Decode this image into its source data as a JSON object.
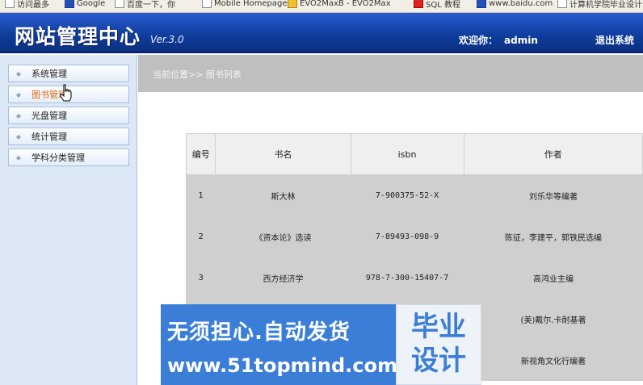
{
  "bookmarks": [
    {
      "label": "访问最多",
      "icon": "page-icon"
    },
    {
      "label": "Google",
      "icon": "google-icon"
    },
    {
      "label": "百度一下，你",
      "icon": "page-icon"
    },
    {
      "label": "Mobile Homepage",
      "icon": "page-icon"
    },
    {
      "label": "EVO2MaxB - EVO2Max",
      "icon": "star-icon"
    },
    {
      "label": "SQL 教程",
      "icon": "red-icon"
    },
    {
      "label": "www.baidu.com",
      "icon": "blue-icon"
    },
    {
      "label": "计算机学院毕业设计",
      "icon": "page-icon"
    }
  ],
  "header": {
    "brand": "网站管理中心",
    "version": "Ver.3.0",
    "welcome_label": "欢迎你：",
    "username": "admin",
    "logout": "退出系统"
  },
  "sidebar": {
    "items": [
      {
        "label": "系统管理",
        "active": false
      },
      {
        "label": "图书管理",
        "active": true
      },
      {
        "label": "光盘管理",
        "active": false
      },
      {
        "label": "统计管理",
        "active": false
      },
      {
        "label": "学科分类管理",
        "active": false
      }
    ]
  },
  "breadcrumb": {
    "text": "当前位置>> 图书列表"
  },
  "table": {
    "headers": [
      "编号",
      "书名",
      "isbn",
      "作者"
    ],
    "rows": [
      [
        "1",
        "斯大林",
        "7-900375-52-X",
        "刘乐华等编著"
      ],
      [
        "2",
        "《资本论》选读",
        "7-89493-098-9",
        "陈征，李建平，郭铁民选编"
      ],
      [
        "3",
        "西方经济学",
        "978-7-300-15407-7",
        "高鸿业主编"
      ],
      [
        "",
        "",
        "",
        "(美)戴尔.卡耐基著"
      ],
      [
        "",
        "",
        "",
        "新视角文化行编著"
      ]
    ]
  },
  "watermark": {
    "slogan": "无须担心.自动发货",
    "site": "www.51topmind.com",
    "badge": "毕业\n设计"
  },
  "colors": {
    "header_bg": "#103f9e",
    "sidebar_bg": "#dce8f6",
    "active_menu_text": "#d9680a",
    "breadcrumb_bg": "#bfbfbf",
    "row_bg": "#cfcfcf",
    "watermark_blue": "#3a7ed8"
  }
}
